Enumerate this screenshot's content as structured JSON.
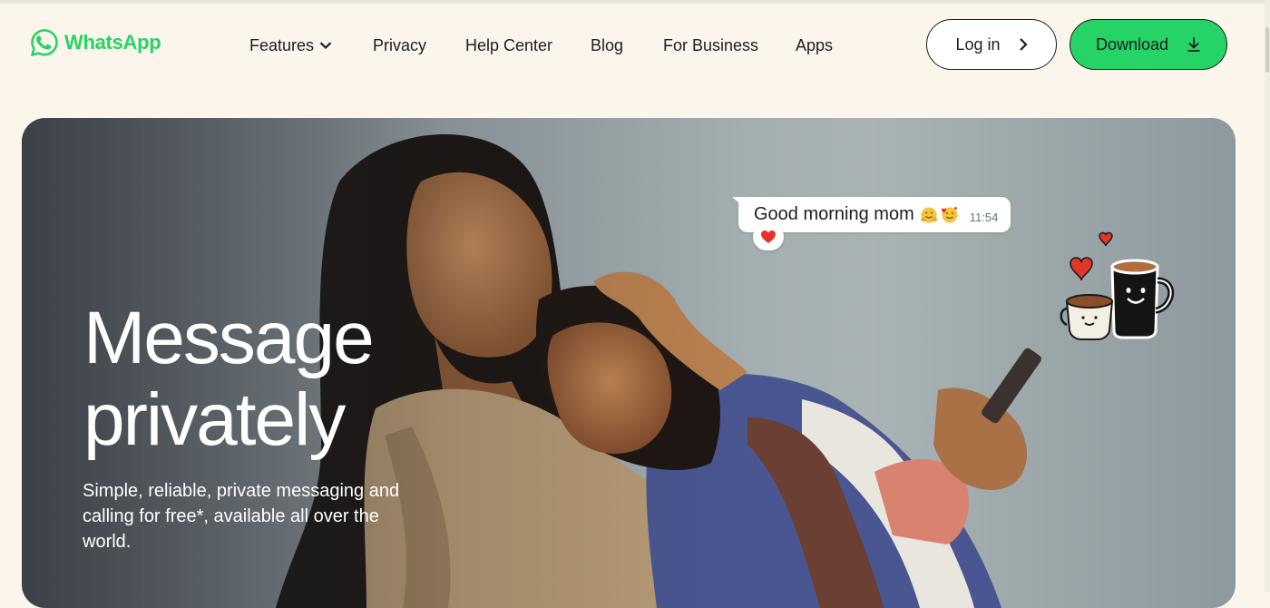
{
  "brand": {
    "name": "WhatsApp",
    "color": "#25d366"
  },
  "nav": {
    "items": [
      {
        "label": "Features",
        "has_dropdown": true
      },
      {
        "label": "Privacy"
      },
      {
        "label": "Help Center"
      },
      {
        "label": "Blog"
      },
      {
        "label": "For Business"
      },
      {
        "label": "Apps"
      }
    ]
  },
  "actions": {
    "login_label": "Log in",
    "download_label": "Download"
  },
  "hero": {
    "headline_line1": "Message",
    "headline_line2": "privately",
    "subtitle": "Simple, reliable, private messaging and calling for free*, available all over the world.",
    "chat_bubble": {
      "text": "Good morning mom",
      "emojis": [
        "hugging-face",
        "smiling-face-with-hearts"
      ],
      "time": "11:54",
      "reaction": "red-heart"
    },
    "sticker": "coffee-mugs-with-hearts"
  },
  "colors": {
    "page_background": "#fcf5eb",
    "download_button": "#25d366",
    "text": "#1c1e21"
  }
}
